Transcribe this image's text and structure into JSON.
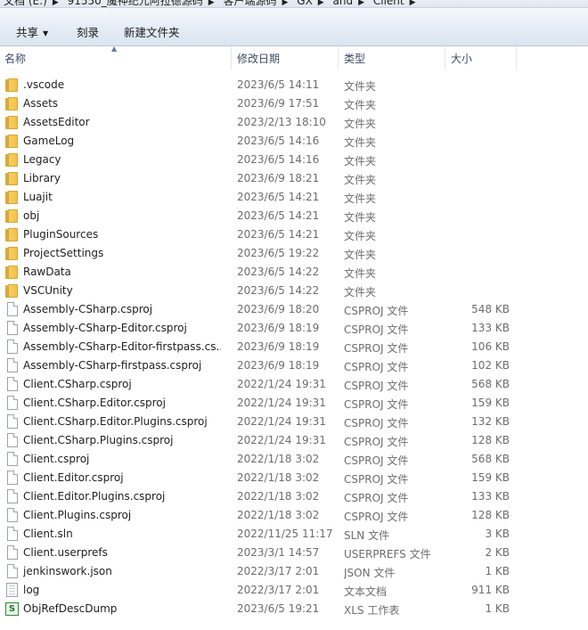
{
  "breadcrumb": {
    "segments": [
      "文档 (E:)",
      "91550_魔神纪元阿拉德源码",
      "客户端源码",
      "GX",
      "and",
      "Client"
    ]
  },
  "toolbar": {
    "share_label": "共享",
    "burn_label": "刻录",
    "new_folder_label": "新建文件夹"
  },
  "columns": {
    "name": "名称",
    "date": "修改日期",
    "type": "类型",
    "size": "大小"
  },
  "files": [
    {
      "name": ".vscode",
      "date": "2023/6/5 14:11",
      "type": "文件夹",
      "size": "",
      "icon": "folder-icon"
    },
    {
      "name": "Assets",
      "date": "2023/6/9 17:51",
      "type": "文件夹",
      "size": "",
      "icon": "folder-icon"
    },
    {
      "name": "AssetsEditor",
      "date": "2023/2/13 18:10",
      "type": "文件夹",
      "size": "",
      "icon": "folder-icon"
    },
    {
      "name": "GameLog",
      "date": "2023/6/5 14:16",
      "type": "文件夹",
      "size": "",
      "icon": "folder-icon"
    },
    {
      "name": "Legacy",
      "date": "2023/6/5 14:16",
      "type": "文件夹",
      "size": "",
      "icon": "folder-icon"
    },
    {
      "name": "Library",
      "date": "2023/6/9 18:21",
      "type": "文件夹",
      "size": "",
      "icon": "folder-icon"
    },
    {
      "name": "Luajit",
      "date": "2023/6/5 14:21",
      "type": "文件夹",
      "size": "",
      "icon": "folder-icon"
    },
    {
      "name": "obj",
      "date": "2023/6/5 14:21",
      "type": "文件夹",
      "size": "",
      "icon": "folder-icon"
    },
    {
      "name": "PluginSources",
      "date": "2023/6/5 14:21",
      "type": "文件夹",
      "size": "",
      "icon": "folder-icon"
    },
    {
      "name": "ProjectSettings",
      "date": "2023/6/5 19:22",
      "type": "文件夹",
      "size": "",
      "icon": "folder-icon"
    },
    {
      "name": "RawData",
      "date": "2023/6/5 14:22",
      "type": "文件夹",
      "size": "",
      "icon": "folder-icon"
    },
    {
      "name": "VSCUnity",
      "date": "2023/6/5 14:22",
      "type": "文件夹",
      "size": "",
      "icon": "folder-icon"
    },
    {
      "name": "Assembly-CSharp.csproj",
      "date": "2023/6/9 18:20",
      "type": "CSPROJ 文件",
      "size": "548 KB",
      "icon": "file-icon"
    },
    {
      "name": "Assembly-CSharp-Editor.csproj",
      "date": "2023/6/9 18:19",
      "type": "CSPROJ 文件",
      "size": "133 KB",
      "icon": "file-icon"
    },
    {
      "name": "Assembly-CSharp-Editor-firstpass.cs...",
      "date": "2023/6/9 18:19",
      "type": "CSPROJ 文件",
      "size": "106 KB",
      "icon": "file-icon"
    },
    {
      "name": "Assembly-CSharp-firstpass.csproj",
      "date": "2023/6/9 18:19",
      "type": "CSPROJ 文件",
      "size": "102 KB",
      "icon": "file-icon"
    },
    {
      "name": "Client.CSharp.csproj",
      "date": "2022/1/24 19:31",
      "type": "CSPROJ 文件",
      "size": "568 KB",
      "icon": "file-icon"
    },
    {
      "name": "Client.CSharp.Editor.csproj",
      "date": "2022/1/24 19:31",
      "type": "CSPROJ 文件",
      "size": "159 KB",
      "icon": "file-icon"
    },
    {
      "name": "Client.CSharp.Editor.Plugins.csproj",
      "date": "2022/1/24 19:31",
      "type": "CSPROJ 文件",
      "size": "132 KB",
      "icon": "file-icon"
    },
    {
      "name": "Client.CSharp.Plugins.csproj",
      "date": "2022/1/24 19:31",
      "type": "CSPROJ 文件",
      "size": "128 KB",
      "icon": "file-icon"
    },
    {
      "name": "Client.csproj",
      "date": "2022/1/18 3:02",
      "type": "CSPROJ 文件",
      "size": "568 KB",
      "icon": "file-icon"
    },
    {
      "name": "Client.Editor.csproj",
      "date": "2022/1/18 3:02",
      "type": "CSPROJ 文件",
      "size": "159 KB",
      "icon": "file-icon"
    },
    {
      "name": "Client.Editor.Plugins.csproj",
      "date": "2022/1/18 3:02",
      "type": "CSPROJ 文件",
      "size": "133 KB",
      "icon": "file-icon"
    },
    {
      "name": "Client.Plugins.csproj",
      "date": "2022/1/18 3:02",
      "type": "CSPROJ 文件",
      "size": "128 KB",
      "icon": "file-icon"
    },
    {
      "name": "Client.sln",
      "date": "2022/11/25 11:17",
      "type": "SLN 文件",
      "size": "3 KB",
      "icon": "file-icon"
    },
    {
      "name": "Client.userprefs",
      "date": "2023/3/1 14:57",
      "type": "USERPREFS 文件",
      "size": "2 KB",
      "icon": "file-icon"
    },
    {
      "name": "jenkinswork.json",
      "date": "2022/3/17 2:01",
      "type": "JSON 文件",
      "size": "1 KB",
      "icon": "file-icon"
    },
    {
      "name": "log",
      "date": "2022/3/17 2:01",
      "type": "文本文档",
      "size": "911 KB",
      "icon": "text-document-icon"
    },
    {
      "name": "ObjRefDescDump",
      "date": "2023/6/5 19:21",
      "type": "XLS 工作表",
      "size": "1 KB",
      "icon": "spreadsheet-icon"
    }
  ]
}
